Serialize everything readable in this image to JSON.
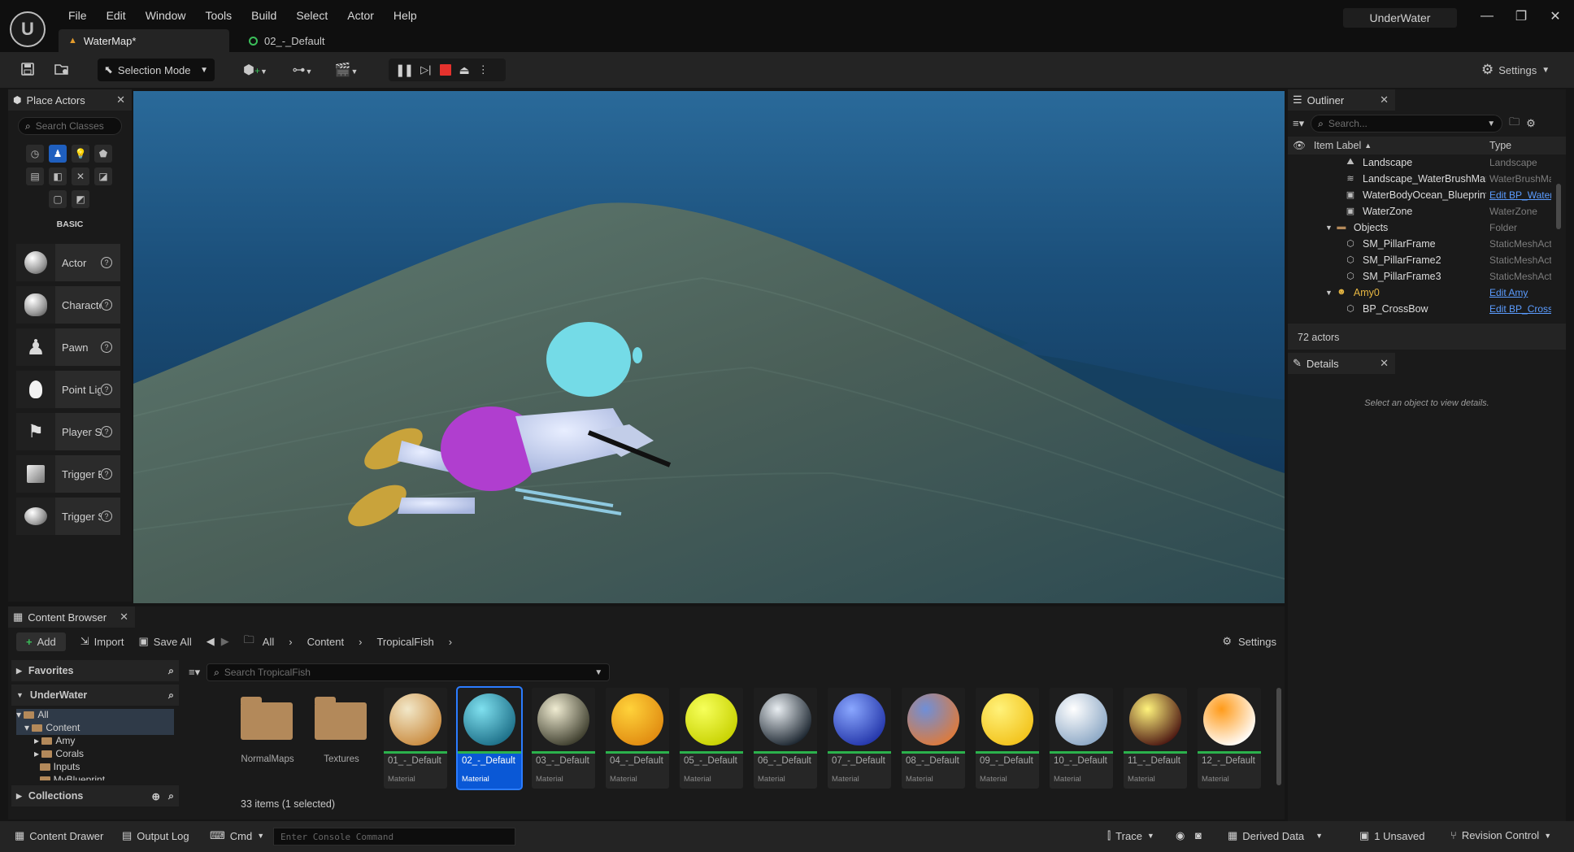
{
  "app": {
    "project_name": "UnderWater"
  },
  "menu": [
    "File",
    "Edit",
    "Window",
    "Tools",
    "Build",
    "Select",
    "Actor",
    "Help"
  ],
  "window_controls": {
    "minimize": "—",
    "restore": "❐",
    "close": "✕"
  },
  "tabs": [
    {
      "label": "WaterMap*",
      "icon": "level-icon",
      "active": true
    },
    {
      "label": "02_-_Default",
      "icon": "material-icon",
      "active": false
    }
  ],
  "toolbar": {
    "selection_mode": "Selection Mode",
    "settings": "Settings"
  },
  "place_actors": {
    "title": "Place Actors",
    "search_placeholder": "Search Classes",
    "category": "BASIC",
    "items": [
      "Actor",
      "Character",
      "Pawn",
      "Point Light",
      "Player Start",
      "Trigger Box",
      "Trigger Sphere"
    ]
  },
  "outliner": {
    "title": "Outliner",
    "search_placeholder": "Search...",
    "col_label": "Item Label",
    "col_type": "Type",
    "rows": [
      {
        "label": "Landscape",
        "type": "Landscape",
        "link": false,
        "indent": 2,
        "icon": "landscape-icon"
      },
      {
        "label": "Landscape_WaterBrushManager",
        "type": "WaterBrushManager",
        "link": false,
        "indent": 2,
        "icon": "brush-icon"
      },
      {
        "label": "WaterBodyOcean_Blueprint",
        "type": "Edit BP_WaterBody",
        "link": true,
        "indent": 2,
        "icon": "actor-icon"
      },
      {
        "label": "WaterZone",
        "type": "WaterZone",
        "link": false,
        "indent": 2,
        "icon": "actor-icon"
      },
      {
        "label": "Objects",
        "type": "Folder",
        "link": false,
        "indent": 1,
        "icon": "folder-icon"
      },
      {
        "label": "SM_PillarFrame",
        "type": "StaticMeshActor",
        "link": false,
        "indent": 2,
        "icon": "mesh-icon"
      },
      {
        "label": "SM_PillarFrame2",
        "type": "StaticMeshActor",
        "link": false,
        "indent": 2,
        "icon": "mesh-icon"
      },
      {
        "label": "SM_PillarFrame3",
        "type": "StaticMeshActor",
        "link": false,
        "indent": 2,
        "icon": "mesh-icon"
      },
      {
        "label": "Amy0",
        "type": "Edit Amy",
        "link": true,
        "indent": 1,
        "icon": "character-icon"
      },
      {
        "label": "BP_CrossBow",
        "type": "Edit BP_CrossBow",
        "link": true,
        "indent": 2,
        "icon": "mesh-icon"
      }
    ],
    "count": "72 actors"
  },
  "details": {
    "title": "Details",
    "empty": "Select an object to view details."
  },
  "content_browser": {
    "title": "Content Browser",
    "add": "Add",
    "import": "Import",
    "save_all": "Save All",
    "breadcrumb": [
      "All",
      "Content",
      "TropicalFish"
    ],
    "settings": "Settings",
    "search_placeholder": "Search TropicalFish",
    "favorites": "Favorites",
    "project": "UnderWater",
    "tree": [
      "All",
      "Content",
      "Amy",
      "Corals",
      "Inputs",
      "MyBlueprint"
    ],
    "collections": "Collections",
    "status": "33 items (1 selected)",
    "folders": [
      "NormalMaps",
      "Textures"
    ],
    "assets": [
      {
        "name": "01_-_Default",
        "kind": "Material",
        "colors": [
          "#f2e8c9",
          "#c98a3e"
        ],
        "selected": false
      },
      {
        "name": "02_-_Default",
        "kind": "Material",
        "colors": [
          "#7fe0ef",
          "#1b6d86"
        ],
        "selected": true
      },
      {
        "name": "03_-_Default",
        "kind": "Material",
        "colors": [
          "#f0ecd2",
          "#3a3a2a"
        ],
        "selected": false
      },
      {
        "name": "04_-_Default",
        "kind": "Material",
        "colors": [
          "#ffd23a",
          "#e08a10"
        ],
        "selected": false
      },
      {
        "name": "05_-_Default",
        "kind": "Material",
        "colors": [
          "#f6ff5a",
          "#c7d100"
        ],
        "selected": false
      },
      {
        "name": "06_-_Default",
        "kind": "Material",
        "colors": [
          "#e9eef2",
          "#18222c"
        ],
        "selected": false
      },
      {
        "name": "07_-_Default",
        "kind": "Material",
        "colors": [
          "#8aa7ff",
          "#2234a8"
        ],
        "selected": false
      },
      {
        "name": "08_-_Default",
        "kind": "Material",
        "colors": [
          "#6f8fd8",
          "#e07a38"
        ],
        "selected": false
      },
      {
        "name": "09_-_Default",
        "kind": "Material",
        "colors": [
          "#fff27a",
          "#f2c21a"
        ],
        "selected": false
      },
      {
        "name": "10_-_Default",
        "kind": "Material",
        "colors": [
          "#ffffff",
          "#8aa6c4"
        ],
        "selected": false
      },
      {
        "name": "11_-_Default",
        "kind": "Material",
        "colors": [
          "#fff37c",
          "#4a1410"
        ],
        "selected": false
      },
      {
        "name": "12_-_Default",
        "kind": "Material",
        "colors": [
          "#ff9b1a",
          "#ffffff"
        ],
        "selected": false
      }
    ]
  },
  "statusbar": {
    "content_drawer": "Content Drawer",
    "output_log": "Output Log",
    "cmd": "Cmd",
    "console_placeholder": "Enter Console Command",
    "trace": "Trace",
    "derived_data": "Derived Data",
    "unsaved": "1 Unsaved",
    "revision_control": "Revision Control"
  }
}
